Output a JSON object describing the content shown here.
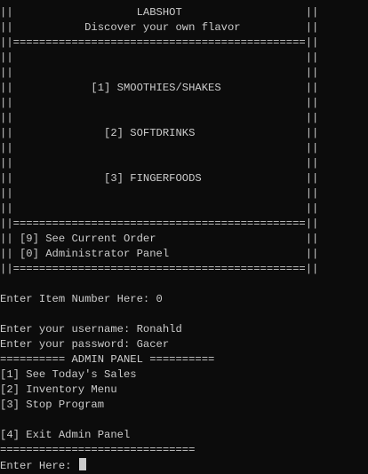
{
  "terminal": {
    "lines": [
      "||                   LABSHOT                   ||",
      "||           Discover your own flavor          ||",
      "||=============================================||",
      "||                                             ||",
      "||                                             ||",
      "||            [1] SMOOTHIES/SHAKES             ||",
      "||                                             ||",
      "||                                             ||",
      "||              [2] SOFTDRINKS                 ||",
      "||                                             ||",
      "||                                             ||",
      "||              [3] FINGERFOODS                ||",
      "||                                             ||",
      "||                                             ||",
      "||=============================================||",
      "|| [9] See Current Order                       ||",
      "|| [0] Administrator Panel                     ||",
      "||=============================================||",
      "",
      "Enter Item Number Here: 0",
      "",
      "Enter your username: Ronahld",
      "Enter your password: Gacer",
      "========== ADMIN PANEL ==========",
      "[1] See Today's Sales",
      "[2] Inventory Menu",
      "[3] Stop Program",
      "",
      "[4] Exit Admin Panel",
      "==============================",
      "Enter Here: "
    ]
  },
  "colors": {
    "background": "#0c0c0c",
    "foreground": "#cccccc"
  }
}
